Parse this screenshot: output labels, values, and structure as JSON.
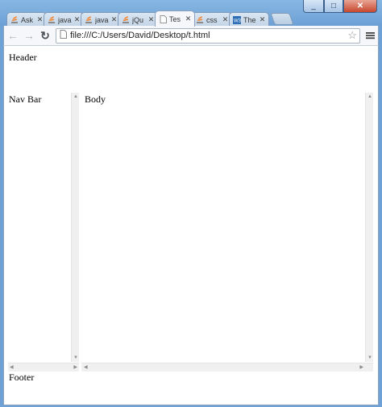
{
  "window": {
    "controls": {
      "minimize": "_",
      "maximize": "□",
      "close": "✕"
    }
  },
  "tabs": [
    {
      "label": "Ask",
      "icon": "stackoverflow-icon",
      "active": false
    },
    {
      "label": "java",
      "icon": "stackoverflow-icon",
      "active": false
    },
    {
      "label": "java",
      "icon": "stackoverflow-icon",
      "active": false
    },
    {
      "label": "jQu",
      "icon": "stackoverflow-icon",
      "active": false
    },
    {
      "label": "Tes",
      "icon": "page-icon",
      "active": true
    },
    {
      "label": "css",
      "icon": "stackoverflow-icon",
      "active": false
    },
    {
      "label": "The",
      "icon": "w3schools-icon",
      "active": false
    }
  ],
  "toolbar": {
    "url": "file:///C:/Users/David/Desktop/t.html"
  },
  "page": {
    "header": "Header",
    "nav": "Nav Bar",
    "body": "Body",
    "footer": "Footer"
  }
}
